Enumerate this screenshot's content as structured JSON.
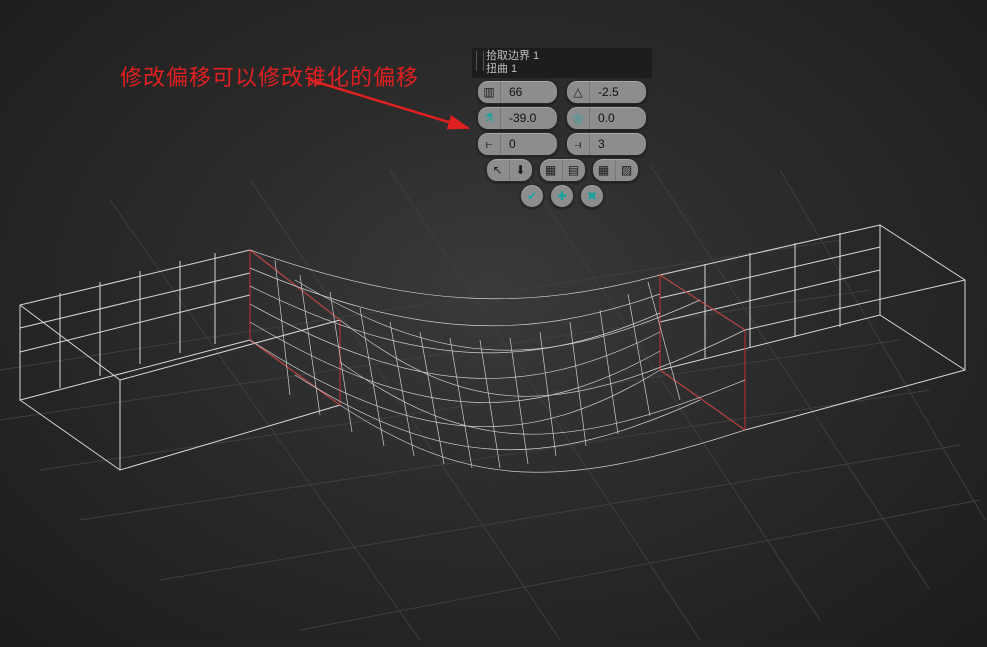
{
  "annotation": {
    "text": "修改偏移可以修改锥化的偏移"
  },
  "panel": {
    "header": {
      "line1": "拾取边界 1",
      "line2": "扭曲 1"
    },
    "fields": {
      "segments": {
        "icon": "segments-icon",
        "value": "66"
      },
      "taper": {
        "icon": "taper-icon",
        "value": "-2.5"
      },
      "offset": {
        "icon": "offset-icon",
        "value": "-39.0"
      },
      "twist": {
        "icon": "twist-icon",
        "value": "0.0"
      },
      "bias_a": {
        "icon": "bias-a-icon",
        "value": "0"
      },
      "bias_b": {
        "icon": "bias-b-icon",
        "value": "3"
      }
    },
    "actions": {
      "select_down": "select",
      "grid_a": "grid-a",
      "grid_b": "grid-b",
      "confirm": "ok",
      "add": "add",
      "cancel": "cancel"
    }
  }
}
